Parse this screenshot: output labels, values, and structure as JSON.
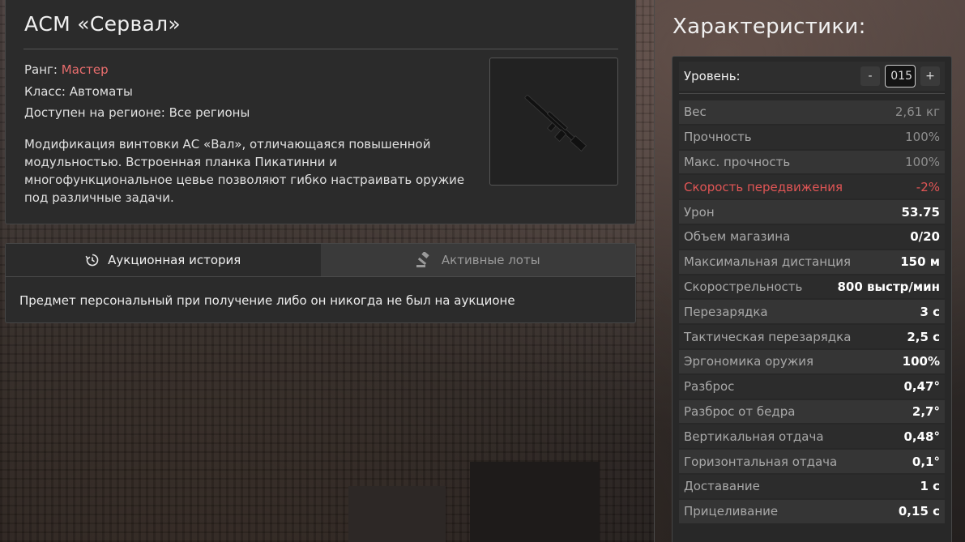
{
  "item": {
    "title": "АСМ «Сервал»",
    "rank_label": "Ранг: ",
    "rank_value": "Мастер",
    "class_label": "Класс: ",
    "class_value": "Автоматы",
    "region_label": "Доступен на регионе: ",
    "region_value": "Все регионы",
    "description": "Модификация винтовки АС «Вал», отличающаяся повышенной модульностью. Встроенная планка Пикатинни и многофункциональное цевье позволяют гибко настраивать оружие под различные задачи.",
    "rank_color": "#e86d6d"
  },
  "auction": {
    "tabs": [
      {
        "label": "Аукционная история",
        "icon": "history-icon",
        "active": true
      },
      {
        "label": "Активные лоты",
        "icon": "gavel-icon",
        "active": false
      }
    ],
    "message": "Предмет персональный при получение либо он никогда не был на аукционе"
  },
  "stats": {
    "title": "Характеристики:",
    "level_label": "Уровень:",
    "level_value": "015",
    "minus_label": "-",
    "plus_label": "+",
    "rows": [
      {
        "label": "Вес",
        "value": "2,61 кг",
        "style": "dim"
      },
      {
        "label": "Прочность",
        "value": "100%",
        "style": "dim"
      },
      {
        "label": "Макс. прочность",
        "value": "100%",
        "style": "dim"
      },
      {
        "label": "Скорость передвижения",
        "value": "-2%",
        "style": "neg"
      },
      {
        "label": "Урон",
        "value": "53.75",
        "style": "strong"
      },
      {
        "label": "Объем магазина",
        "value": "0/20",
        "style": "strong"
      },
      {
        "label": "Максимальная дистанция",
        "value": "150 м",
        "style": "strong"
      },
      {
        "label": "Скорострельность",
        "value": "800 выстр/мин",
        "style": "strong"
      },
      {
        "label": "Перезарядка",
        "value": "3 с",
        "style": "strong"
      },
      {
        "label": "Тактическая перезарядка",
        "value": "2,5 с",
        "style": "strong"
      },
      {
        "label": "Эргономика оружия",
        "value": "100%",
        "style": "strong"
      },
      {
        "label": "Разброс",
        "value": "0,47°",
        "style": "strong"
      },
      {
        "label": "Разброс от бедра",
        "value": "2,7°",
        "style": "strong"
      },
      {
        "label": "Вертикальная отдача",
        "value": "0,48°",
        "style": "strong"
      },
      {
        "label": "Горизонтальная отдача",
        "value": "0,1°",
        "style": "strong"
      },
      {
        "label": "Доставание",
        "value": "1 с",
        "style": "strong"
      },
      {
        "label": "Прицеливание",
        "value": "0,15 с",
        "style": "strong"
      }
    ],
    "negative_color": "#e05555"
  }
}
